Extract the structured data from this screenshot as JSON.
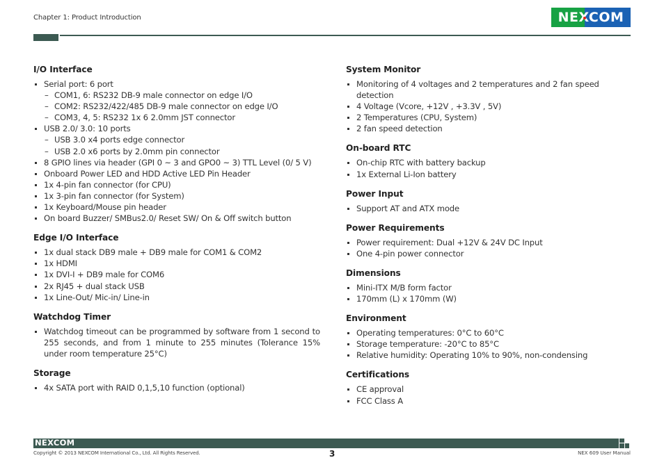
{
  "header": {
    "chapter": "Chapter 1: Product Introduction",
    "logo_text": "NEXCOM",
    "brand_colors": {
      "green": "#17a244",
      "blue": "#1b62b4",
      "accent_red": "#e4261b",
      "rule": "#3c5a52"
    }
  },
  "left_column": [
    {
      "title": "I/O Interface",
      "items": [
        {
          "text": "Serial port: 6 port",
          "level": 1
        },
        {
          "text": "COM1, 6: RS232 DB-9 male connector on edge I/O",
          "level": 2
        },
        {
          "text": "COM2: RS232/422/485 DB-9 male connector on edge I/O",
          "level": 2
        },
        {
          "text": "COM3, 4, 5: RS232 1x 6 2.0mm JST connector",
          "level": 2
        },
        {
          "text": "USB 2.0/ 3.0: 10 ports",
          "level": 1
        },
        {
          "text": "USB 3.0 x4 ports edge connector",
          "level": 2
        },
        {
          "text": "USB 2.0 x6 ports by 2.0mm pin connector",
          "level": 2
        },
        {
          "text": "8 GPIO lines via header (GPI 0 ~ 3 and GPO0 ~ 3) TTL Level (0/ 5 V)",
          "level": 1
        },
        {
          "text": "Onboard Power LED and HDD Active LED Pin Header",
          "level": 1
        },
        {
          "text": "1x 4-pin fan connector (for CPU)",
          "level": 1
        },
        {
          "text": "1x 3-pin fan connector (for System)",
          "level": 1
        },
        {
          "text": "1x Keyboard/Mouse pin header",
          "level": 1
        },
        {
          "text": "On board Buzzer/ SMBus2.0/ Reset SW/ On & Off switch button",
          "level": 1
        }
      ]
    },
    {
      "title": "Edge I/O Interface",
      "items": [
        {
          "text": "1x dual stack DB9 male + DB9 male for COM1 & COM2",
          "level": 1
        },
        {
          "text": "1x HDMI",
          "level": 1
        },
        {
          "text": "1x DVI-I + DB9 male for COM6",
          "level": 1
        },
        {
          "text": "2x RJ45 + dual stack USB",
          "level": 1
        },
        {
          "text": "1x Line-Out/ Mic-in/ Line-in",
          "level": 1
        }
      ]
    },
    {
      "title": "Watchdog Timer",
      "items": [
        {
          "text": "Watchdog timeout can be programmed by software from 1 second to 255 seconds, and from 1 minute to 255 minutes (Tolerance 15% under room temperature 25°C)",
          "level": 1,
          "justify": true
        }
      ]
    },
    {
      "title": "Storage",
      "items": [
        {
          "text": "4x SATA port with RAID 0,1,5,10 function (optional)",
          "level": 1
        }
      ]
    }
  ],
  "right_column": [
    {
      "title": "System Monitor",
      "items": [
        {
          "text": "Monitoring of 4 voltages and 2 temperatures and 2 fan speed detection",
          "level": 1
        },
        {
          "text": "4 Voltage (Vcore, +12V , +3.3V , 5V)",
          "level": 1
        },
        {
          "text": "2 Temperatures (CPU, System)",
          "level": 1
        },
        {
          "text": "2 fan speed detection",
          "level": 1
        }
      ]
    },
    {
      "title": "On-board RTC",
      "items": [
        {
          "text": "On-chip RTC with battery backup",
          "level": 1
        },
        {
          "text": "1x External Li-Ion battery",
          "level": 1
        }
      ]
    },
    {
      "title": "Power Input",
      "items": [
        {
          "text": "Support AT and ATX mode",
          "level": 1
        }
      ]
    },
    {
      "title": "Power Requirements",
      "items": [
        {
          "text": "Power requirement: Dual +12V & 24V DC Input",
          "level": 1
        },
        {
          "text": "One 4-pin power connector",
          "level": 1
        }
      ]
    },
    {
      "title": "Dimensions",
      "items": [
        {
          "text": "Mini-ITX M/B form factor",
          "level": 1
        },
        {
          "text": "170mm (L) x 170mm (W)",
          "level": 1
        }
      ]
    },
    {
      "title": "Environment",
      "items": [
        {
          "text": "Operating temperatures: 0°C to 60°C",
          "level": 1
        },
        {
          "text": "Storage temperature: -20°C to 85°C",
          "level": 1
        },
        {
          "text": "Relative humidity: Operating 10% to 90%, non-condensing",
          "level": 1
        }
      ]
    },
    {
      "title": "Certifications",
      "items": [
        {
          "text": "CE approval",
          "level": 1
        },
        {
          "text": "FCC Class A",
          "level": 1
        }
      ]
    }
  ],
  "footer": {
    "logo_text": "NEXCOM",
    "copyright": "Copyright © 2013 NEXCOM International Co., Ltd. All Rights Reserved.",
    "page_number": "3",
    "manual_name": "NEX 609 User Manual"
  }
}
